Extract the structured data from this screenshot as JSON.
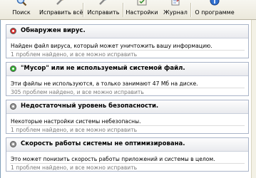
{
  "toolbar": {
    "buttons": [
      {
        "label": "Поиск",
        "icon": "search-icon"
      },
      {
        "label": "Исправить всё",
        "icon": "fix-all-icon"
      },
      {
        "label": "Исправить",
        "icon": "fix-icon"
      },
      {
        "label": "Настройки",
        "icon": "settings-icon"
      },
      {
        "label": "Журнал",
        "icon": "log-icon"
      },
      {
        "label": "О программе",
        "icon": "about-icon"
      }
    ]
  },
  "cards": [
    {
      "title": "Обнаружен вирус.",
      "description": "Найден файл вируса, который может уничтожить вашу информацию.",
      "stats": "1 проблем найдено, и все можно исправить",
      "status_color": "#d93030"
    },
    {
      "title": "\"Мусор\" или не используемый системой файл.",
      "description": "Эти файлы не используются, а только занимают 47 Мб на диске.",
      "stats": "305 проблем найдено, и все можно исправить",
      "status_color": "#2fb52f"
    },
    {
      "title": "Недостаточный уровень безопасности.",
      "description": "Некоторые настройки системы небезопасны.",
      "stats": "1 проблем найдено, и все можно исправить",
      "status_color": "#9a9a9a"
    },
    {
      "title": "Скорость работы системы не оптимизирована.",
      "description": "Это может понизить скорость работы приложений и системы в целом.",
      "stats": "1 проблем найдено, и все можно исправить",
      "status_color": "#9a9a9a"
    }
  ]
}
